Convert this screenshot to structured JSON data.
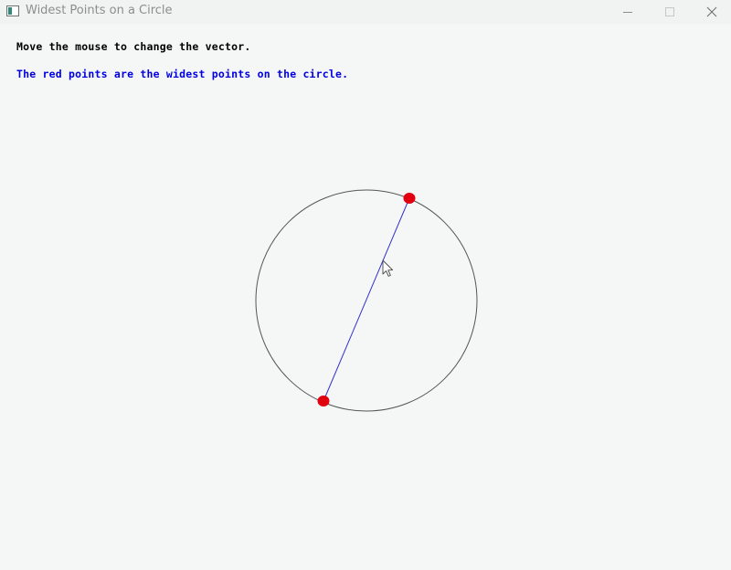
{
  "window": {
    "title": "Widest Points on a Circle"
  },
  "icons": {
    "app": "app-window-icon",
    "minimize": "minimize-icon",
    "maximize": "maximize-icon",
    "close": "close-icon",
    "cursor": "mouse-cursor-icon"
  },
  "canvas": {
    "instruction": "Move the mouse to change the vector.",
    "description": "The red points are the widest points on the circle."
  },
  "colors": {
    "background": "#f4f7f5",
    "instruction_text": "#000000",
    "description_text": "#0000e0",
    "circle_stroke": "#555555",
    "vector_line": "#3030d0",
    "widest_points": "#e00010"
  }
}
